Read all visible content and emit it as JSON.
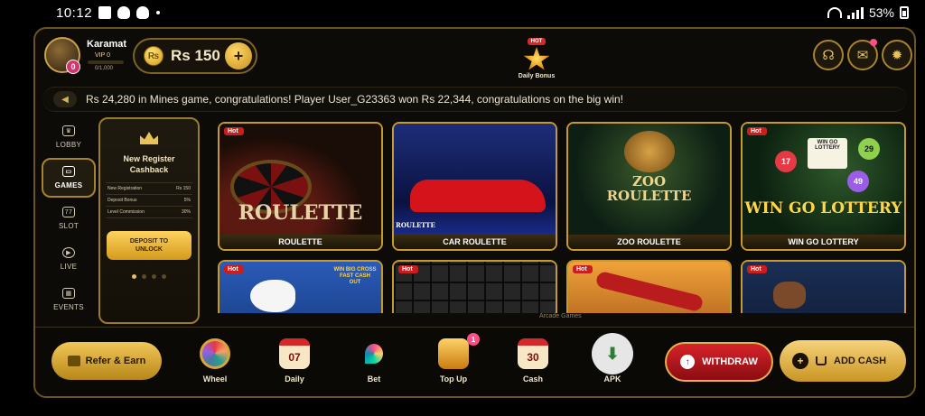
{
  "status_bar": {
    "time": "10:12",
    "battery": "53%"
  },
  "user": {
    "name": "Karamat",
    "vip": "VIP 0",
    "vip_progress": "0/1,000",
    "avatar_badge": "0"
  },
  "balance": {
    "amount": "Rs 150",
    "plus": "+"
  },
  "daily_bonus": {
    "hot": "HOT",
    "label": "Daily Bonus"
  },
  "header_icons": [
    "headset-icon",
    "mail-icon",
    "gear-icon"
  ],
  "marquee": {
    "text": "Rs 24,280 in Mines game, congratulations! Player User_G23363 won Rs 22,344, congratulations on the big win!"
  },
  "sidebar": {
    "items": [
      {
        "label": "LOBBY",
        "icon": "lobby-icon"
      },
      {
        "label": "GAMES",
        "icon": "games-icon",
        "active": true
      },
      {
        "label": "SLOT",
        "icon": "slot-icon",
        "glyph": "77"
      },
      {
        "label": "LIVE",
        "icon": "live-icon"
      },
      {
        "label": "EVENTS",
        "icon": "events-icon"
      }
    ]
  },
  "promo": {
    "title": "New Register Cashback",
    "rows": [
      {
        "label": "New Registration",
        "value": "Rs 150"
      },
      {
        "label": "Deposit Bonus",
        "value": "5%"
      },
      {
        "label": "Level Commission",
        "value": "30%"
      }
    ],
    "cta": "DEPOSIT TO UNLOCK"
  },
  "games": [
    {
      "name": "ROULETTE",
      "hot": "Hot",
      "art_title": "ROULETTE"
    },
    {
      "name": "CAR ROULETTE",
      "hot": "",
      "art_title": "ROULETTE"
    },
    {
      "name": "ZOO ROULETTE",
      "hot": "",
      "art_title": "ZOO ROULETTE"
    },
    {
      "name": "WIN GO LOTTERY",
      "hot": "Hot",
      "art_title": "WIN GO LOTTERY",
      "balls": [
        "17",
        "29",
        "49"
      ],
      "sign": "WIN GO LOTTERY"
    },
    {
      "name": "",
      "hot": "Hot",
      "art_title": "WIN BIG CROSS FAST CASH OUT"
    },
    {
      "name": "",
      "hot": "Hot",
      "art_title": ""
    },
    {
      "name": "",
      "hot": "Hot",
      "art_title": ""
    },
    {
      "name": "",
      "hot": "Hot",
      "art_title": ""
    }
  ],
  "section_caption": "Arcade Games",
  "bottom_nav": {
    "refer": "Refer & Earn",
    "items": [
      {
        "label": "Wheel",
        "glyph": ""
      },
      {
        "label": "Daily",
        "glyph": "07"
      },
      {
        "label": "Bet",
        "glyph": ""
      },
      {
        "label": "Top Up",
        "glyph": "",
        "badge": "1"
      },
      {
        "label": "Cash",
        "glyph": "30"
      },
      {
        "label": "APK",
        "glyph": "⬇"
      }
    ],
    "withdraw": "WITHDRAW",
    "add_cash": "ADD CASH"
  }
}
